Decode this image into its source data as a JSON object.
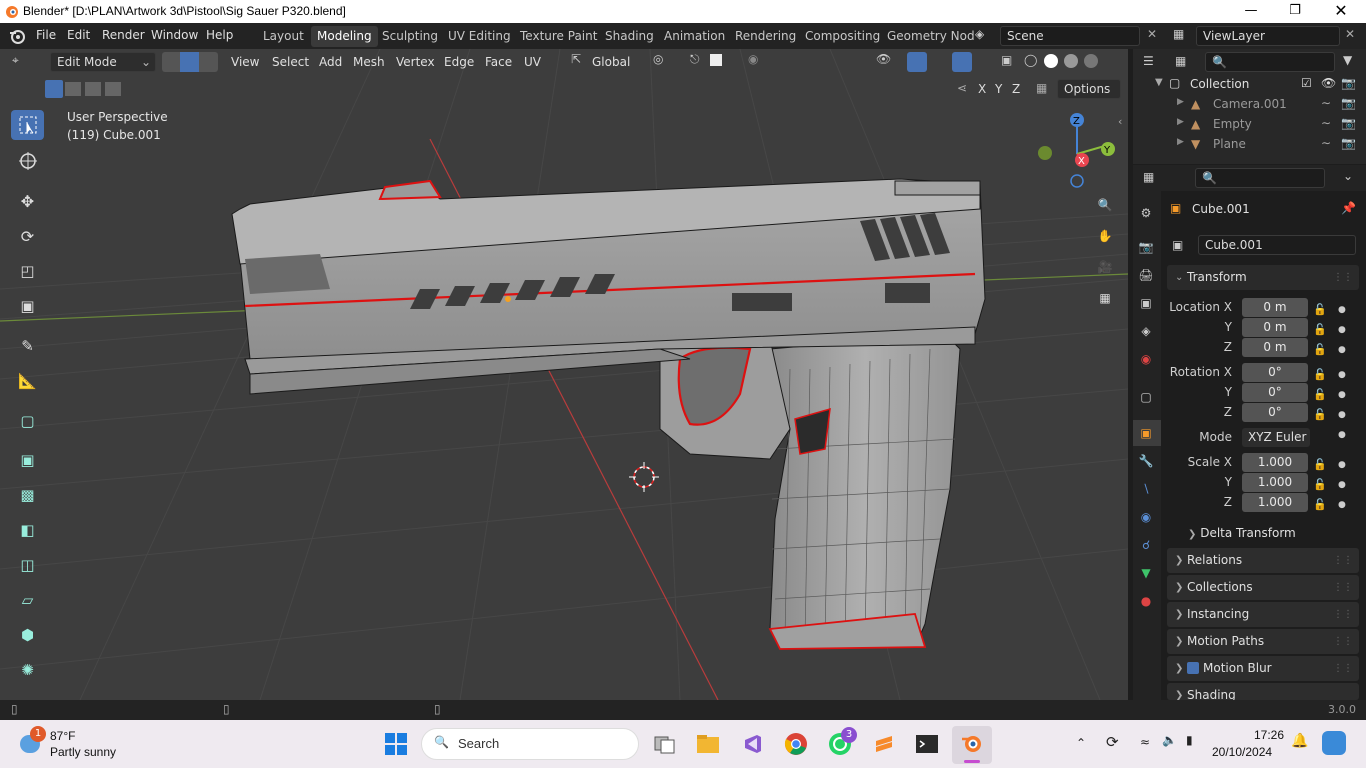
{
  "window": {
    "title": "Blender* [D:\\PLAN\\Artwork 3d\\Pistool\\Sig Sauer P320.blend]"
  },
  "menus": [
    "File",
    "Edit",
    "Render",
    "Window",
    "Help"
  ],
  "workspaces": [
    "Layout",
    "Modeling",
    "Sculpting",
    "UV Editing",
    "Texture Paint",
    "Shading",
    "Animation",
    "Rendering",
    "Compositing",
    "Geometry Nod"
  ],
  "active_workspace": "Modeling",
  "scene": "Scene",
  "view_layer": "ViewLayer",
  "viewport_header": {
    "mode": "Edit Mode",
    "menus": [
      "View",
      "Select",
      "Add",
      "Mesh",
      "Vertex",
      "Edge",
      "Face",
      "UV"
    ],
    "orientation": "Global",
    "options": "Options",
    "axes": [
      "X",
      "Y",
      "Z"
    ]
  },
  "viewport": {
    "perspective": "User Perspective",
    "object_info": "(119) Cube.001",
    "gizmo": {
      "x": "X",
      "y": "Y",
      "z": "Z"
    }
  },
  "outliner": {
    "items": [
      {
        "name": "Collection",
        "icon": "collection-icon"
      },
      {
        "name": "Camera.001",
        "icon": "camera-icon"
      },
      {
        "name": "Empty",
        "icon": "empty-icon"
      },
      {
        "name": "Plane",
        "icon": "mesh-icon"
      }
    ]
  },
  "properties": {
    "object_name": "Cube.001",
    "data_name": "Cube.001",
    "transform": {
      "header": "Transform",
      "location_label": "Location X",
      "location": [
        "0 m",
        "0 m",
        "0 m"
      ],
      "rotation_label": "Rotation X",
      "rotation": [
        "0°",
        "0°",
        "0°"
      ],
      "mode_label": "Mode",
      "mode": "XYZ Euler",
      "scale_label": "Scale X",
      "scale": [
        "1.000",
        "1.000",
        "1.000"
      ],
      "y_label": "Y",
      "z_label": "Z",
      "delta": "Delta Transform"
    },
    "panels": [
      "Relations",
      "Collections",
      "Instancing",
      "Motion Paths",
      "Motion Blur",
      "Shading"
    ]
  },
  "status": {
    "version": "3.0.0"
  },
  "taskbar": {
    "weather_temp": "87°F",
    "weather_desc": "Partly sunny",
    "weather_badge": "1",
    "search": "Search",
    "whatsapp_badge": "3",
    "time": "17:26",
    "date": "20/10/2024"
  },
  "colors": {
    "accent": "#4772b3",
    "edge_select": "#e52020",
    "x_axis": "#e94550",
    "y_axis": "#8cbe3c",
    "z_axis": "#4584d7"
  }
}
